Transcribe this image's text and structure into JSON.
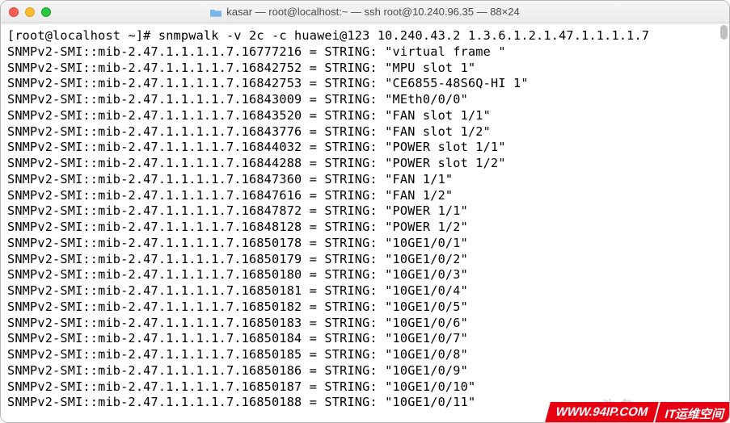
{
  "titlebar": {
    "title": "kasar — root@localhost:~ — ssh root@10.240.96.35 — 88×24"
  },
  "terminal": {
    "prompt": "[root@localhost ~]# ",
    "command": "snmpwalk -v 2c -c huawei@123 10.240.43.2 1.3.6.1.2.1.47.1.1.1.1.7",
    "oid_prefix": "SNMPv2-SMI::mib-2.47.1.1.1.1.7.",
    "type_label": "STRING",
    "rows": [
      {
        "oid": "16777216",
        "value": "virtual frame "
      },
      {
        "oid": "16842752",
        "value": "MPU slot 1"
      },
      {
        "oid": "16842753",
        "value": "CE6855-48S6Q-HI 1"
      },
      {
        "oid": "16843009",
        "value": "MEth0/0/0"
      },
      {
        "oid": "16843520",
        "value": "FAN slot 1/1"
      },
      {
        "oid": "16843776",
        "value": "FAN slot 1/2"
      },
      {
        "oid": "16844032",
        "value": "POWER slot 1/1"
      },
      {
        "oid": "16844288",
        "value": "POWER slot 1/2"
      },
      {
        "oid": "16847360",
        "value": "FAN 1/1"
      },
      {
        "oid": "16847616",
        "value": "FAN 1/2"
      },
      {
        "oid": "16847872",
        "value": "POWER 1/1"
      },
      {
        "oid": "16848128",
        "value": "POWER 1/2"
      },
      {
        "oid": "16850178",
        "value": "10GE1/0/1"
      },
      {
        "oid": "16850179",
        "value": "10GE1/0/2"
      },
      {
        "oid": "16850180",
        "value": "10GE1/0/3"
      },
      {
        "oid": "16850181",
        "value": "10GE1/0/4"
      },
      {
        "oid": "16850182",
        "value": "10GE1/0/5"
      },
      {
        "oid": "16850183",
        "value": "10GE1/0/6"
      },
      {
        "oid": "16850184",
        "value": "10GE1/0/7"
      },
      {
        "oid": "16850185",
        "value": "10GE1/0/8"
      },
      {
        "oid": "16850186",
        "value": "10GE1/0/9"
      },
      {
        "oid": "16850187",
        "value": "10GE1/0/10"
      },
      {
        "oid": "16850188",
        "value": "10GE1/0/11"
      }
    ]
  },
  "watermark": {
    "shadow": "头条",
    "a": "WWW.94IP.COM",
    "b": "IT运维空间"
  }
}
